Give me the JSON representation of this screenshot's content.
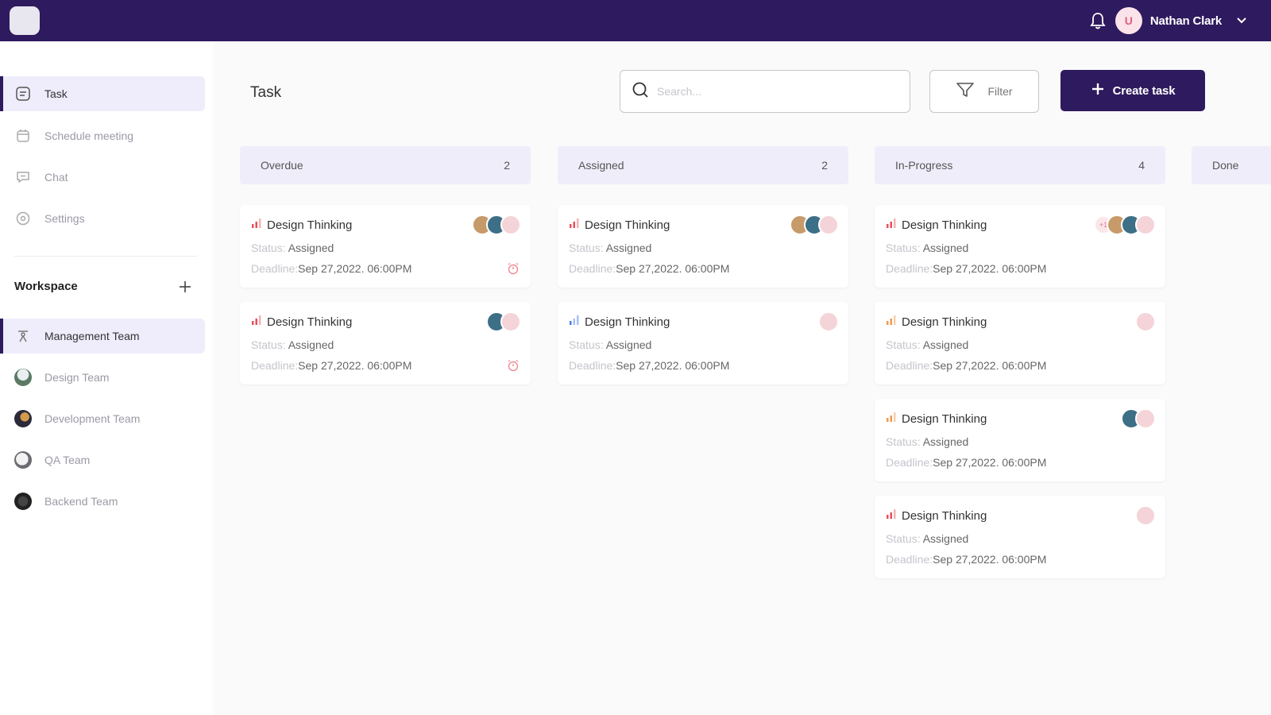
{
  "header": {
    "user_name": "Nathan Clark",
    "user_initial": "U"
  },
  "sidebar": {
    "nav": [
      {
        "label": "Task"
      },
      {
        "label": "Schedule meeting"
      },
      {
        "label": "Chat"
      },
      {
        "label": "Settings"
      }
    ],
    "workspace_title": "Workspace",
    "teams": [
      {
        "label": "Management Team"
      },
      {
        "label": "Design Team"
      },
      {
        "label": "Development Team"
      },
      {
        "label": "QA Team"
      },
      {
        "label": "Backend Team"
      }
    ]
  },
  "main": {
    "title": "Task",
    "search_placeholder": "Search...",
    "filter_label": "Filter",
    "create_label": "Create task",
    "columns": [
      {
        "title": "Overdue",
        "count": "2",
        "cards": [
          {
            "title": "Design Thinking",
            "status_label": "Status:",
            "status": "Assigned",
            "deadline_label": "Deadline:",
            "deadline": "Sep 27,2022. 06:00PM"
          },
          {
            "title": "Design Thinking",
            "status_label": "Status:",
            "status": "Assigned",
            "deadline_label": "Deadline:",
            "deadline": "Sep 27,2022. 06:00PM"
          }
        ]
      },
      {
        "title": "Assigned",
        "count": "2",
        "cards": [
          {
            "title": "Design Thinking",
            "status_label": "Status:",
            "status": "Assigned",
            "deadline_label": "Deadline:",
            "deadline": "Sep 27,2022. 06:00PM"
          },
          {
            "title": "Design Thinking",
            "status_label": "Status:",
            "status": "Assigned",
            "deadline_label": "Deadline:",
            "deadline": "Sep 27,2022. 06:00PM"
          }
        ]
      },
      {
        "title": "In-Progress",
        "count": "4",
        "cards": [
          {
            "title": "Design Thinking",
            "status_label": "Status:",
            "status": "Assigned",
            "deadline_label": "Deadline:",
            "deadline": "Sep 27,2022. 06:00PM",
            "extra_avatars": "+1"
          },
          {
            "title": "Design Thinking",
            "status_label": "Status:",
            "status": "Assigned",
            "deadline_label": "Deadline:",
            "deadline": "Sep 27,2022. 06:00PM"
          },
          {
            "title": "Design Thinking",
            "status_label": "Status:",
            "status": "Assigned",
            "deadline_label": "Deadline:",
            "deadline": "Sep 27,2022. 06:00PM"
          },
          {
            "title": "Design Thinking",
            "status_label": "Status:",
            "status": "Assigned",
            "deadline_label": "Deadline:",
            "deadline": "Sep 27,2022. 06:00PM"
          }
        ]
      },
      {
        "title": "Done"
      }
    ]
  },
  "colors": {
    "brand": "#2e1a5e",
    "column_header_bg": "#f0edfb",
    "priority_high": "#e8505b",
    "priority_low": "#4a7de8"
  },
  "icons": [
    "bell-icon",
    "chevron-down-icon",
    "task-icon",
    "calendar-icon",
    "chat-icon",
    "settings-icon",
    "plus-icon",
    "search-icon",
    "filter-icon",
    "priority-bars-icon",
    "alarm-icon"
  ]
}
